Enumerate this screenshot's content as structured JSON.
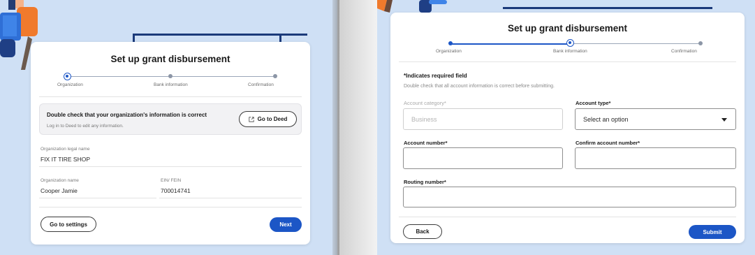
{
  "left_screen": {
    "title": "Set up grant disbursement",
    "steps": [
      {
        "label": "Organization",
        "state": "current"
      },
      {
        "label": "Bank information",
        "state": "upcoming"
      },
      {
        "label": "Confirmation",
        "state": "upcoming"
      }
    ],
    "notice": {
      "heading": "Double check that your organization's information is correct",
      "subtext": "Log in to Deed to edit any information.",
      "button_label": "Go to Deed",
      "button_icon": "external-link-icon"
    },
    "fields": {
      "legal_name_label": "Organization legal name",
      "legal_name_value": "FIX IT TIRE SHOP",
      "org_name_label": "Organization name",
      "org_name_value": "Cooper Jamie",
      "ein_label": "EIN/ FEIN",
      "ein_value": "700014741"
    },
    "secondary_button": "Go to settings",
    "primary_button": "Next"
  },
  "right_screen": {
    "title": "Set up grant disbursement",
    "steps": [
      {
        "label": "Organization",
        "state": "done"
      },
      {
        "label": "Bank information",
        "state": "current"
      },
      {
        "label": "Confirmation",
        "state": "upcoming"
      }
    ],
    "required_note": "*Indicates required field",
    "instructions": "Double check that all account information is correct before submitting.",
    "form": {
      "account_category_label": "Account category*",
      "account_category_value": "Business",
      "account_type_label": "Account type*",
      "account_type_placeholder": "Select an option",
      "account_number_label": "Account number*",
      "confirm_account_number_label": "Confirm account number*",
      "routing_number_label": "Routing number*"
    },
    "secondary_button": "Back",
    "primary_button": "Submit"
  },
  "colors": {
    "accent": "#1c56c6",
    "background": "#cfe0f5",
    "illustration": "#1b3a7a"
  }
}
